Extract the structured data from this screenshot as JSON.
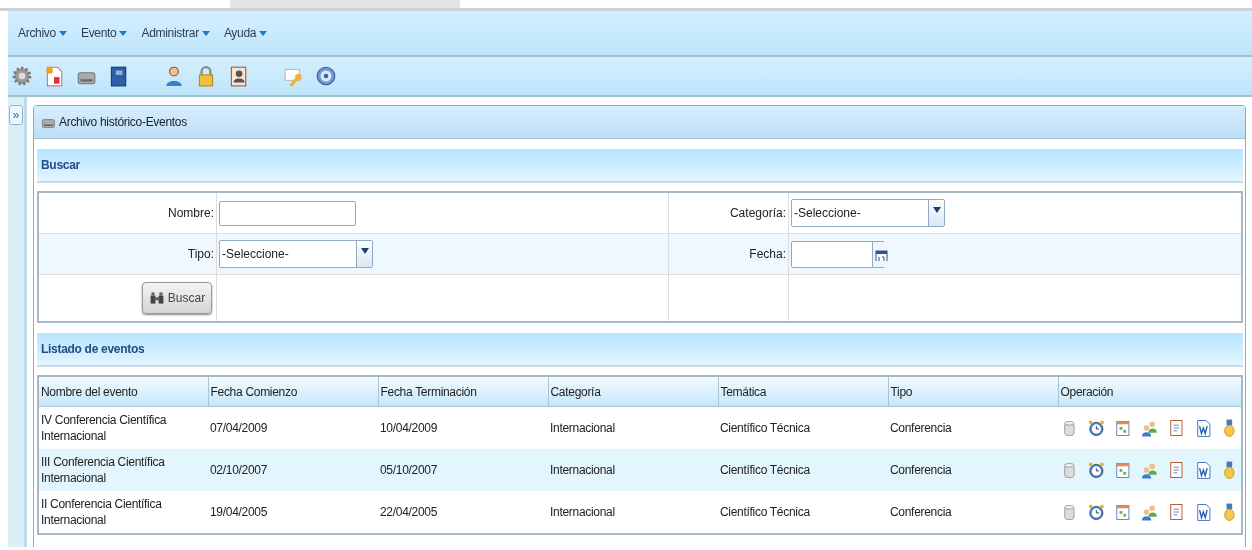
{
  "menu": [
    {
      "label": "Archivo"
    },
    {
      "label": "Evento"
    },
    {
      "label": "Administrar"
    },
    {
      "label": "Ayuda"
    }
  ],
  "sidebar": {
    "toggle": "»"
  },
  "panel": {
    "title": "Archivo histórico-Eventos"
  },
  "search": {
    "title": "Buscar",
    "fields": [
      {
        "label": "Nombre:",
        "kind": "text"
      },
      {
        "label": "Categoría:",
        "kind": "select",
        "value": "-Seleccione-"
      },
      {
        "label": "Tipo:",
        "kind": "select",
        "value": "-Seleccione-"
      },
      {
        "label": "Fecha:",
        "kind": "date"
      }
    ],
    "button": "Buscar"
  },
  "list": {
    "title": "Listado de eventos",
    "columns": [
      "Nombre del evento",
      "Fecha Comienzo",
      "Fecha Terminación",
      "Categoría",
      "Temática",
      "Tipo",
      "Operación"
    ],
    "rows": [
      [
        "IV Conferencia Científica Internacional",
        "07/04/2009",
        "10/04/2009",
        "Internacional",
        "Científico Técnica",
        "Conferencia"
      ],
      [
        "III Conferencia Científica Internacional",
        "02/10/2007",
        "05/10/2007",
        "Internacional",
        "Científico Técnica",
        "Conferencia"
      ],
      [
        "II Conferencia Científica Internacional",
        "19/04/2005",
        "22/04/2005",
        "Internacional",
        "Científico Técnica",
        "Conferencia"
      ]
    ]
  }
}
